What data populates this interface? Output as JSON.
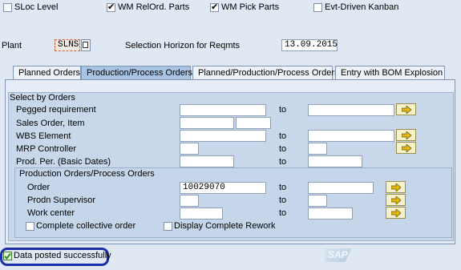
{
  "top_options": {
    "sloc_level": {
      "label": "SLoc Level",
      "checked": false
    },
    "wm_relord_parts": {
      "label": "WM RelOrd. Parts",
      "checked": true
    },
    "wm_pick_parts": {
      "label": "WM Pick Parts",
      "checked": true
    },
    "evt_driven_kanban": {
      "label": "Evt-Driven Kanban",
      "checked": false
    }
  },
  "header": {
    "plant_label": "Plant",
    "plant_value": "SLNS",
    "horizon_label": "Selection Horizon for Reqmts",
    "horizon_value": "13.09.2015"
  },
  "tabs": [
    {
      "label": "Planned Orders",
      "active": false
    },
    {
      "label": "Production/Process Orders",
      "active": true
    },
    {
      "label": "Planned/Production/Process Orders",
      "active": false
    },
    {
      "label": "Entry with BOM Explosion",
      "active": false
    }
  ],
  "select_by_orders": {
    "title": "Select by Orders",
    "pegged_label": "Pegged requirement",
    "sales_order_label": "Sales Order, Item",
    "wbs_label": "WBS Element",
    "mrp_label": "MRP Controller",
    "prod_per_label": "Prod. Per. (Basic Dates)",
    "to_label": "to"
  },
  "prod_orders": {
    "title": "Production Orders/Process Orders",
    "order_label": "Order",
    "order_value": "10029070",
    "supervisor_label": "Prodn Supervisor",
    "workcenter_label": "Work center",
    "complete_collective_label": "Complete collective order",
    "display_rework_label": "Display Complete Rework",
    "to_label": "to"
  },
  "status": {
    "message": "Data posted successfully",
    "logo": "SAP"
  },
  "colors": {
    "background": "#dfe8f3",
    "active_tab": "#a9c4e2",
    "status_ring": "#1d2fa8"
  }
}
